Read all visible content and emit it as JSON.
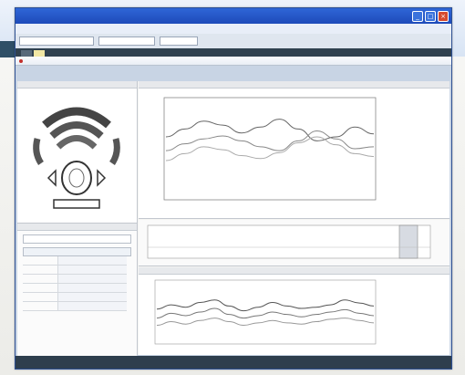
{
  "window": {
    "title": "",
    "buttons": [
      "minimize-icon",
      "maximize-icon",
      "close-icon"
    ]
  },
  "menubar": {
    "items": []
  },
  "tabs": [
    {
      "label": ""
    },
    {
      "label": ""
    }
  ],
  "chart_data": [
    {
      "type": "line",
      "title": "",
      "xlabel": "",
      "ylabel": "",
      "series": [
        {
          "values": [
            0.62,
            0.7,
            0.78,
            0.74,
            0.66,
            0.72,
            0.8,
            0.7,
            0.58,
            0.62,
            0.72,
            0.65
          ]
        },
        {
          "values": [
            0.48,
            0.55,
            0.6,
            0.63,
            0.58,
            0.52,
            0.48,
            0.58,
            0.68,
            0.6,
            0.5,
            0.52
          ]
        },
        {
          "values": [
            0.38,
            0.45,
            0.52,
            0.49,
            0.43,
            0.4,
            0.46,
            0.56,
            0.62,
            0.54,
            0.45,
            0.42
          ]
        }
      ],
      "ylim": [
        0,
        1
      ]
    },
    {
      "type": "line",
      "title": "",
      "series": [
        {
          "values": [
            0.55,
            0.62,
            0.58,
            0.66,
            0.7,
            0.6,
            0.52,
            0.58,
            0.66,
            0.6,
            0.56,
            0.58,
            0.62,
            0.7,
            0.65,
            0.6
          ]
        },
        {
          "values": [
            0.4,
            0.48,
            0.44,
            0.5,
            0.56,
            0.46,
            0.4,
            0.44,
            0.5,
            0.46,
            0.42,
            0.46,
            0.5,
            0.54,
            0.48,
            0.44
          ]
        },
        {
          "values": [
            0.28,
            0.34,
            0.3,
            0.36,
            0.4,
            0.34,
            0.28,
            0.32,
            0.36,
            0.32,
            0.3,
            0.34,
            0.38,
            0.4,
            0.36,
            0.32
          ]
        }
      ],
      "ylim": [
        0,
        1
      ]
    }
  ]
}
